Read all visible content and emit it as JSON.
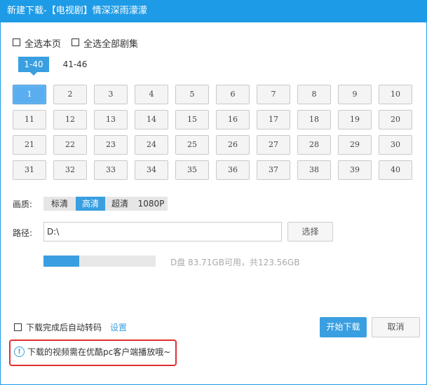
{
  "window": {
    "title": "新建下载-【电视剧】情深深雨濛濛"
  },
  "select": {
    "page_label": "全选本页",
    "all_label": "全选全部剧集"
  },
  "tabs": [
    {
      "label": "1-40",
      "active": true
    },
    {
      "label": "41-46",
      "active": false
    }
  ],
  "episodes": [
    "1",
    "2",
    "3",
    "4",
    "5",
    "6",
    "7",
    "8",
    "9",
    "10",
    "11",
    "12",
    "13",
    "14",
    "15",
    "16",
    "17",
    "18",
    "19",
    "20",
    "21",
    "22",
    "23",
    "24",
    "25",
    "26",
    "27",
    "28",
    "29",
    "30",
    "31",
    "32",
    "33",
    "34",
    "35",
    "36",
    "37",
    "38",
    "39",
    "40"
  ],
  "selected_episode": "1",
  "quality": {
    "label": "画质:",
    "options": [
      "标清",
      "高清",
      "超清",
      "1080P"
    ],
    "selected": "高清"
  },
  "path": {
    "label": "路径:",
    "value": "D:\\",
    "choose_label": "选择"
  },
  "disk": {
    "used_fraction": 0.32,
    "text": "D盘 83.71GB可用，共123.56GB"
  },
  "bottom": {
    "auto_convert_label": "下载完成后自动转码",
    "settings_label": "设置",
    "start_label": "开始下载",
    "cancel_label": "取消"
  },
  "notice": {
    "text": "下载的视频需在优酷pc客户端播放哦~",
    "icon": "!"
  },
  "colors": {
    "accent": "#3a9fe0",
    "titlebar": "#1e9be6",
    "notice_border": "#e03030"
  }
}
